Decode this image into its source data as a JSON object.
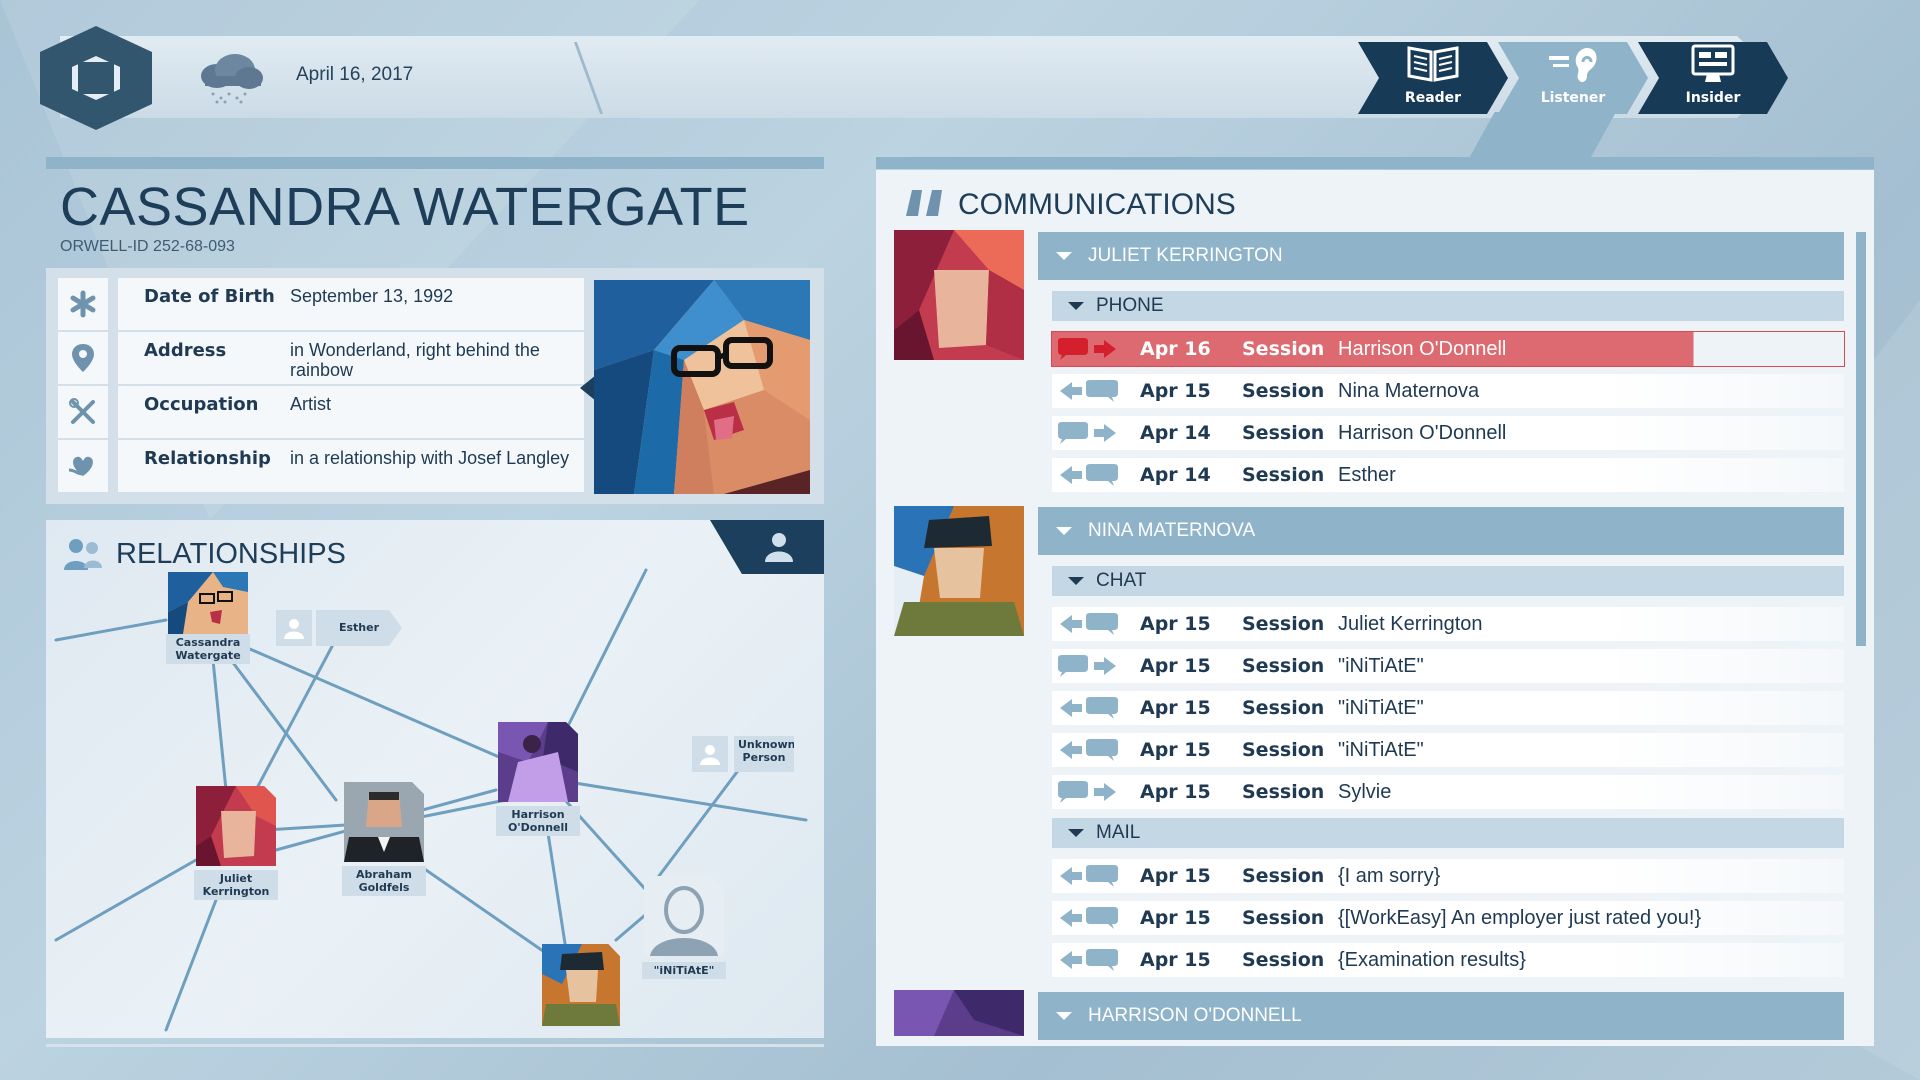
{
  "topbar": {
    "date": "April 16, 2017",
    "weather_icon": "rain-cloud-icon",
    "modes": [
      {
        "label": "Reader",
        "icon": "book-icon",
        "active": false
      },
      {
        "label": "Listener",
        "icon": "ear-icon",
        "active": true
      },
      {
        "label": "Insider",
        "icon": "monitor-icon",
        "active": false
      }
    ]
  },
  "profile": {
    "name": "CASSANDRA WATERGATE",
    "orwell_id": "ORWELL-ID  252-68-093",
    "fields": [
      {
        "icon": "asterisk-icon",
        "label": "Date of Birth",
        "value": "September 13, 1992"
      },
      {
        "icon": "location-pin-icon",
        "label": "Address",
        "value": "in Wonderland, right behind the rainbow"
      },
      {
        "icon": "tools-icon",
        "label": "Occupation",
        "value": "Artist"
      },
      {
        "icon": "heart-hand-icon",
        "label": "Relationship",
        "value": "in a relationship with Josef Langley"
      }
    ]
  },
  "relationships": {
    "title": "RELATIONSHIPS",
    "nodes": [
      {
        "label": "Cassandra Watergate"
      },
      {
        "label": "Esther"
      },
      {
        "label": "Harrison O'Donnell"
      },
      {
        "label": "Unknown Person"
      },
      {
        "label": "Juliet Kerrington"
      },
      {
        "label": "Abraham Goldfels"
      },
      {
        "label": "\"iNiTiAtE\""
      }
    ]
  },
  "communications": {
    "title": "COMMUNICATIONS",
    "groups": [
      {
        "contact": "JULIET KERRINGTON",
        "sections": [
          {
            "type": "PHONE",
            "messages": [
              {
                "direction": "outgoing",
                "date": "Apr 16",
                "kind": "Session",
                "contact": "Harrison O'Donnell",
                "selected": true
              },
              {
                "direction": "incoming",
                "date": "Apr 15",
                "kind": "Session",
                "contact": "Nina Maternova"
              },
              {
                "direction": "outgoing",
                "date": "Apr 14",
                "kind": "Session",
                "contact": "Harrison O'Donnell"
              },
              {
                "direction": "incoming",
                "date": "Apr 14",
                "kind": "Session",
                "contact": "Esther"
              }
            ]
          }
        ]
      },
      {
        "contact": "NINA MATERNOVA",
        "sections": [
          {
            "type": "CHAT",
            "messages": [
              {
                "direction": "incoming",
                "date": "Apr 15",
                "kind": "Session",
                "contact": "Juliet Kerrington"
              },
              {
                "direction": "outgoing",
                "date": "Apr 15",
                "kind": "Session",
                "contact": "\"iNiTiAtE\""
              },
              {
                "direction": "incoming",
                "date": "Apr 15",
                "kind": "Session",
                "contact": "\"iNiTiAtE\""
              },
              {
                "direction": "incoming",
                "date": "Apr 15",
                "kind": "Session",
                "contact": "\"iNiTiAtE\""
              },
              {
                "direction": "outgoing",
                "date": "Apr 15",
                "kind": "Session",
                "contact": "Sylvie"
              }
            ]
          },
          {
            "type": "MAIL",
            "messages": [
              {
                "direction": "incoming",
                "date": "Apr 15",
                "kind": "Session",
                "contact": "{I am sorry}"
              },
              {
                "direction": "incoming",
                "date": "Apr 15",
                "kind": "Session",
                "contact": "{[WorkEasy] An employer just rated you!}"
              },
              {
                "direction": "incoming",
                "date": "Apr 15",
                "kind": "Session",
                "contact": "{Examination results}"
              }
            ]
          }
        ]
      },
      {
        "contact": "HARRISON O'DONNELL",
        "sections": []
      }
    ]
  },
  "colors": {
    "accent": "#8fb3c9",
    "dark": "#173b57",
    "selected": "#dc6a70"
  }
}
